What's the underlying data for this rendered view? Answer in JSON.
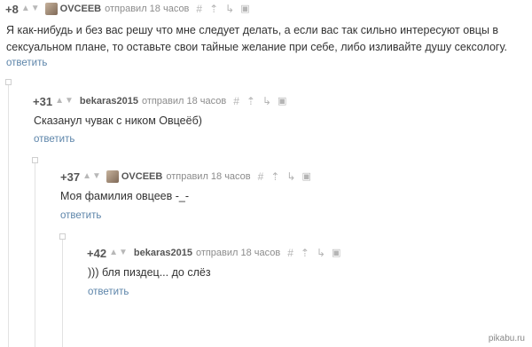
{
  "comments": [
    {
      "rating": "+8",
      "username": "OVCEEB",
      "posted": "отправил 18 часов",
      "text_lines": [
        "Я как-нибудь и без вас решу что мне следует делать, а если вас так сильно интересуют овцы в",
        "сексуальном плане, то оставьте свои тайные желание при себе, либо изливайте душу сексологу."
      ],
      "reply": "ответить"
    },
    {
      "rating": "+31",
      "username": "bekaras2015",
      "posted": "отправил 18 часов",
      "text_lines": [
        "Сказанул чувак с ником Овцеёб)"
      ],
      "reply": "ответить"
    },
    {
      "rating": "+37",
      "username": "OVCEEB",
      "posted": "отправил 18 часов",
      "text_lines": [
        "Моя фамилия овцеев -_-"
      ],
      "reply": "ответить"
    },
    {
      "rating": "+42",
      "username": "bekaras2015",
      "posted": "отправил 18 часов",
      "text_lines": [
        "))) бля пиздец... до слёз"
      ],
      "reply": "ответить"
    }
  ],
  "icons": {
    "upvote": "▲",
    "downvote": "▼",
    "link": "#",
    "parent": "⇡",
    "tree": "↳",
    "save": "▣"
  },
  "watermark": "pikabu.ru",
  "colors": {
    "link": "#5d85aa",
    "rating": "#565656",
    "icon": "#b5b5b5"
  }
}
